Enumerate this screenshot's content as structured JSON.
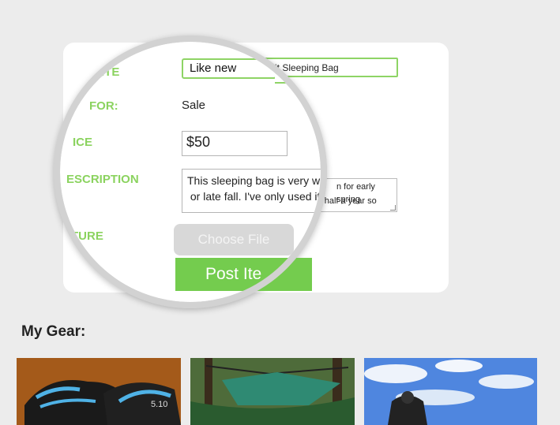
{
  "form": {
    "item_label_partial": "ITE",
    "for_label_partial": "FOR:",
    "price_label_partial": "ICE",
    "description_label_partial": "ESCRIPTION",
    "picture_label_partial": "TURE",
    "item_input_value_partial": "it Sleeping Bag",
    "description_bg_line1": "n for early spring",
    "description_bg_line2": "r half a year so"
  },
  "magnifier": {
    "condition_selected": "Like new",
    "for_value": "Sale",
    "price_currency": "$",
    "price_value": "50",
    "description_text": "This sleeping bag is very wa\n or late fall. I've only used it",
    "choose_file_label": "Choose File",
    "post_button_partial": "Post Ite"
  },
  "gear": {
    "title": "My Gear:",
    "items": [
      {
        "name": "shoes-image",
        "overlay_text": "5.10"
      },
      {
        "name": "hammock-image"
      },
      {
        "name": "backpack-image"
      }
    ]
  },
  "colors": {
    "accent_green": "#8bd35f",
    "button_green": "#74cc4e",
    "background": "#ececec"
  }
}
